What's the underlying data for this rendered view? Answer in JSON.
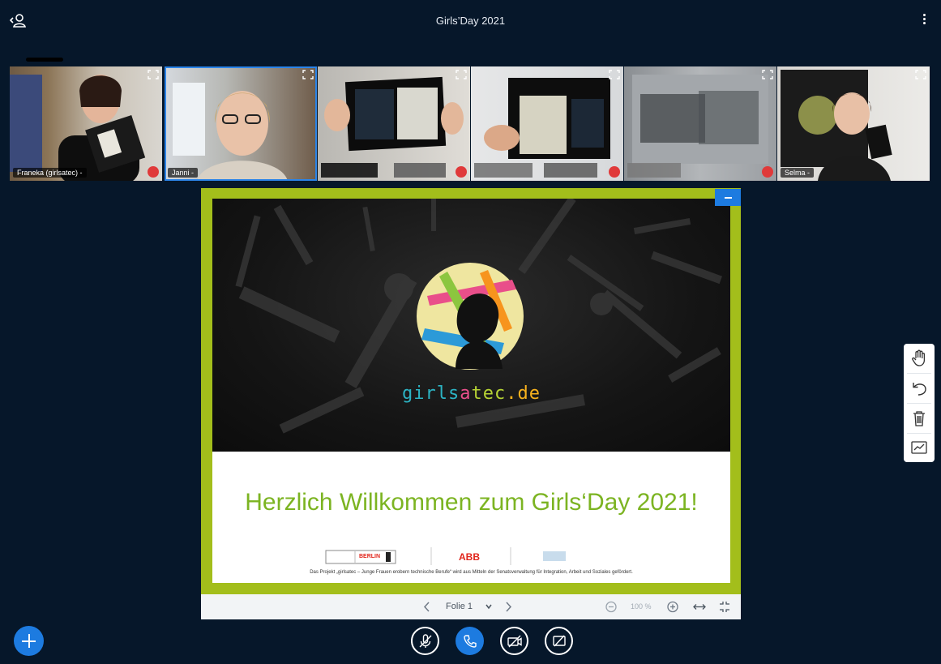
{
  "app": {
    "title": "Girls’Day 2021",
    "users_icon": "users-icon",
    "options_icon": "kebab-menu-icon"
  },
  "colors": {
    "background": "#06172a",
    "accent": "#1d7be0",
    "slide_frame": "#a3be1b",
    "headline": "#7cb422",
    "mute_badge": "#e03a3a"
  },
  "webcams": [
    {
      "label": "Franeka (girlsatec) -",
      "muted": true,
      "active": false
    },
    {
      "label": "Janni -",
      "muted": false,
      "active": true
    },
    {
      "label": "",
      "muted": true,
      "active": false
    },
    {
      "label": "",
      "muted": true,
      "active": false
    },
    {
      "label": "",
      "muted": true,
      "active": false
    },
    {
      "label": "Selma -",
      "muted": false,
      "active": false
    }
  ],
  "presentation": {
    "logo_text": {
      "girls": "girls",
      "a": "a",
      "tec": "tec",
      "dot": ".",
      "de": "de"
    },
    "headline": "Herzlich Willkommen zum Girls‘Day 2021!",
    "partners": [
      "BERLIN",
      "ABB"
    ],
    "footnote": "Das Projekt „girlsatec – Junge Frauen erobern technische Berufe“ wird aus Mitteln der Senatsverwaltung für Integration, Arbeit und Soziales gefördert.",
    "toolbar": {
      "slide_label": "Folie 1",
      "zoom": "100 %",
      "prev_icon": "chevron-left-icon",
      "next_icon": "chevron-right-icon",
      "dropdown_icon": "chevron-down-icon",
      "zoom_out_icon": "zoom-out-icon",
      "zoom_in_icon": "zoom-in-icon",
      "fit_width_icon": "fit-width-icon",
      "fullscreen_icon": "fullscreen-icon"
    }
  },
  "annotation_tools": [
    "hand-icon",
    "undo-icon",
    "trash-icon",
    "whiteboard-icon"
  ],
  "controls": [
    "mic-muted-icon",
    "phone-icon",
    "camera-off-icon",
    "screenshare-off-icon"
  ]
}
